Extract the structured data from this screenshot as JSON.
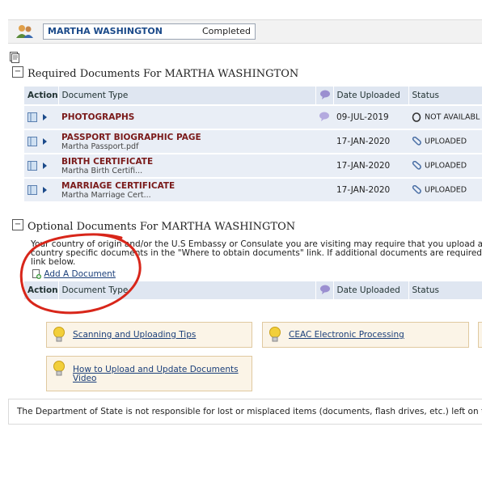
{
  "header": {
    "applicant_name": "MARTHA WASHINGTON",
    "status": "Completed"
  },
  "required": {
    "title": "Required Documents For MARTHA WASHINGTON",
    "columns": {
      "action": "Action",
      "doc_type": "Document Type",
      "date": "Date Uploaded",
      "status": "Status"
    },
    "rows": [
      {
        "title": "PHOTOGRAPHS",
        "file": "",
        "date": "09-JUL-2019",
        "status": "NOT AVAILABL",
        "status_icon": "o-icon"
      },
      {
        "title": "PASSPORT BIOGRAPHIC PAGE",
        "file": "Martha Passport.pdf",
        "date": "17-JAN-2020",
        "status": "UPLOADED",
        "status_icon": "paperclip-icon"
      },
      {
        "title": "BIRTH CERTIFICATE",
        "file": "Martha Birth Certifi...",
        "date": "17-JAN-2020",
        "status": "UPLOADED",
        "status_icon": "paperclip-icon"
      },
      {
        "title": "MARRIAGE CERTIFICATE",
        "file": "Martha Marriage Cert...",
        "date": "17-JAN-2020",
        "status": "UPLOADED",
        "status_icon": "paperclip-icon"
      }
    ]
  },
  "optional": {
    "title": "Optional Documents For MARTHA WASHINGTON",
    "para_line1": "Your country of origin and/or the U.S Embassy or Consulate you are visiting may require that you upload additi",
    "para_line2": "country specific documents in the \"Where to obtain documents\" link. If additional documents are required, plea",
    "para_line3": "link below.",
    "add_link": "Add A Document",
    "columns": {
      "action": "Action",
      "doc_type": "Document Type",
      "date": "Date Uploaded",
      "status": "Status"
    }
  },
  "tips": {
    "scanning": "Scanning and Uploading Tips",
    "ceac": "CEAC Electronic Processing",
    "howto_line1": "How to Upload and Update Documents",
    "howto_line2": "Video"
  },
  "footer": {
    "text": "The Department of State is not responsible for lost or misplaced items (documents, flash drives, etc.) left on third-"
  },
  "colors": {
    "header_bg": "#dfe6f1",
    "row_bg": "#e9eef6",
    "doc_title": "#7a1a1a",
    "link": "#1b3f7a",
    "annotation_circle": "#d8261a"
  }
}
